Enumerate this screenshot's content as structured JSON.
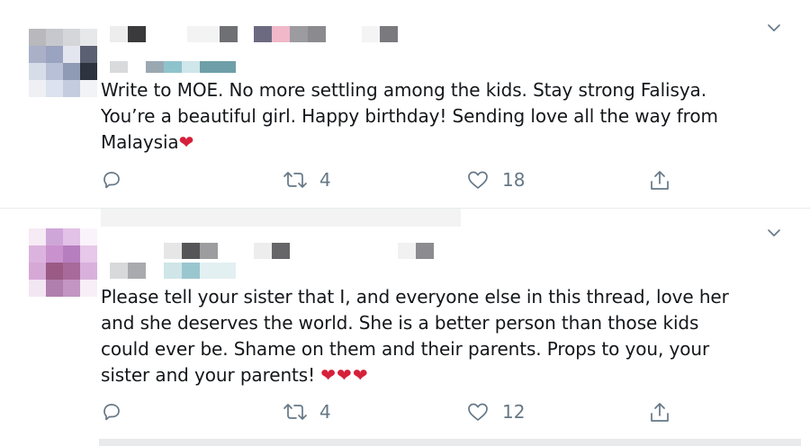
{
  "tweets": [
    {
      "text_lines": [
        "Write to MOE. No more settling among the kids. Stay strong Falisya.",
        "You’re a beautiful girl. Happy birthday! Sending love all the way from",
        "Malaysia"
      ],
      "trailing_emoji": "❤",
      "retweets": "4",
      "likes": "18"
    },
    {
      "text_lines": [
        "Please tell your sister that I, and everyone else in this thread, love her",
        "and she deserves the world. She is a better person than those kids",
        "could ever be. Shame on them and their parents. Props to you, your",
        "sister and your parents!"
      ],
      "trailing_emoji": "❤❤❤",
      "retweets": "4",
      "likes": "12"
    }
  ],
  "icons": {
    "reply": "reply-icon",
    "retweet": "retweet-icon",
    "like": "like-icon",
    "share": "share-icon",
    "menu": "chevron-down-icon"
  },
  "colors": {
    "text": "#14171a",
    "muted": "#657786",
    "heart": "#d6203a",
    "divider": "#e6ecf0"
  }
}
